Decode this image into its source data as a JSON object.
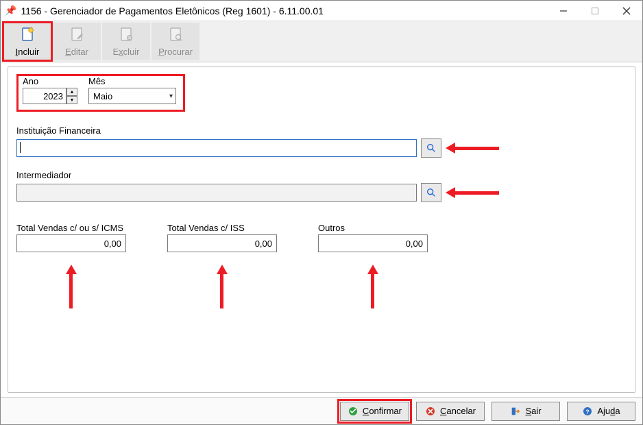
{
  "window": {
    "title": "1156 - Gerenciador de Pagamentos Eletônicos (Reg 1601) - 6.11.00.01"
  },
  "toolbar": {
    "incluir": "Incluir",
    "editar": "Editar",
    "excluir": "Excluir",
    "procurar": "Procurar"
  },
  "period": {
    "ano_label": "Ano",
    "ano_value": "2023",
    "mes_label": "Mês",
    "mes_value": "Maio"
  },
  "instituicao": {
    "label": "Instituição Financeira",
    "value": ""
  },
  "intermediador": {
    "label": "Intermediador",
    "value": ""
  },
  "totais": {
    "icms_label": "Total Vendas c/ ou s/ ICMS",
    "icms_value": "0,00",
    "iss_label": "Total Vendas c/ ISS",
    "iss_value": "0,00",
    "outros_label": "Outros",
    "outros_value": "0,00"
  },
  "actions": {
    "confirmar": "Confirmar",
    "cancelar": "Cancelar",
    "sair": "Sair",
    "ajuda": "Ajuda"
  }
}
